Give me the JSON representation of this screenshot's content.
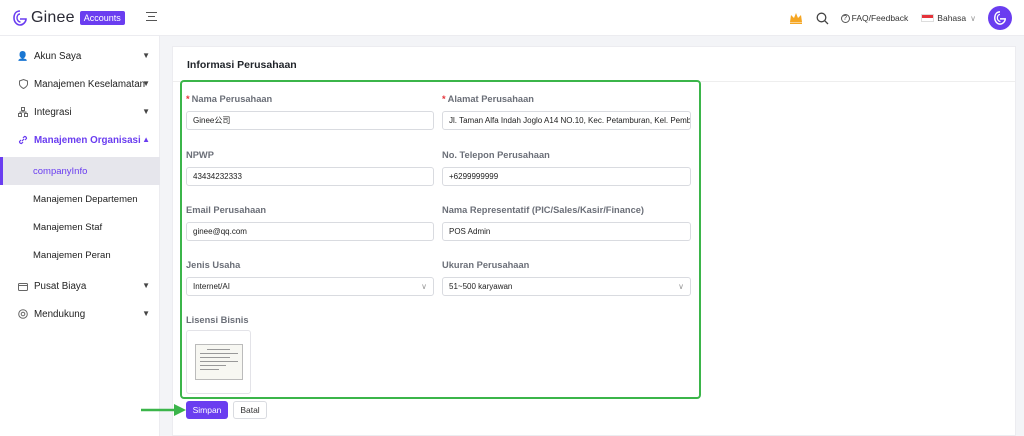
{
  "header": {
    "logo_text": "Ginee",
    "logo_badge": "Accounts",
    "faq_label": "FAQ/Feedback",
    "language_label": "Bahasa",
    "icons": [
      "menu-toggle-icon",
      "crown-icon",
      "search-icon",
      "help-icon",
      "flag-indonesia-icon",
      "avatar-logo-icon"
    ],
    "colors": {
      "accent": "#6a3df0",
      "highlight": "#3bb54a",
      "required": "#e5333a"
    }
  },
  "sidebar": {
    "items": [
      {
        "label": "Akun Saya",
        "icon": "user-icon"
      },
      {
        "label": "Manajemen Keselamatan",
        "icon": "shield-icon"
      },
      {
        "label": "Integrasi",
        "icon": "hierarchy-icon"
      },
      {
        "label": "Manajemen Organisasi",
        "icon": "link-icon"
      },
      {
        "label": "Pusat Biaya",
        "icon": "wallet-icon"
      },
      {
        "label": "Mendukung",
        "icon": "help-icon"
      }
    ],
    "sub_items": [
      {
        "label": "companyInfo"
      },
      {
        "label": "Manajemen Departemen"
      },
      {
        "label": "Manajemen Staf"
      },
      {
        "label": "Manajemen Peran"
      }
    ]
  },
  "main": {
    "title": "Informasi Perusahaan",
    "fields": {
      "company_name": {
        "label": "Nama Perusahaan",
        "value": "Ginee公司"
      },
      "company_address": {
        "label": "Alamat Perusahaan",
        "value": "Jl. Taman Alfa Indah Joglo A14 NO.10, Kec. Petamburan, Kel. Pemb"
      },
      "npwp": {
        "label": "NPWP",
        "value": "43434232333"
      },
      "phone": {
        "label": "No. Telepon Perusahaan",
        "value": "+6299999999"
      },
      "email": {
        "label": "Email Perusahaan",
        "value": "ginee@qq.com"
      },
      "representative": {
        "label": "Nama Representatif (PIC/Sales/Kasir/Finance)",
        "value": "POS Admin"
      },
      "business_type": {
        "label": "Jenis Usaha",
        "value": "Internet/AI"
      },
      "company_size": {
        "label": "Ukuran Perusahaan",
        "value": "51~500 karyawan"
      },
      "license": {
        "label": "Lisensi Bisnis"
      }
    },
    "save_label": "Simpan",
    "cancel_label": "Batal"
  }
}
